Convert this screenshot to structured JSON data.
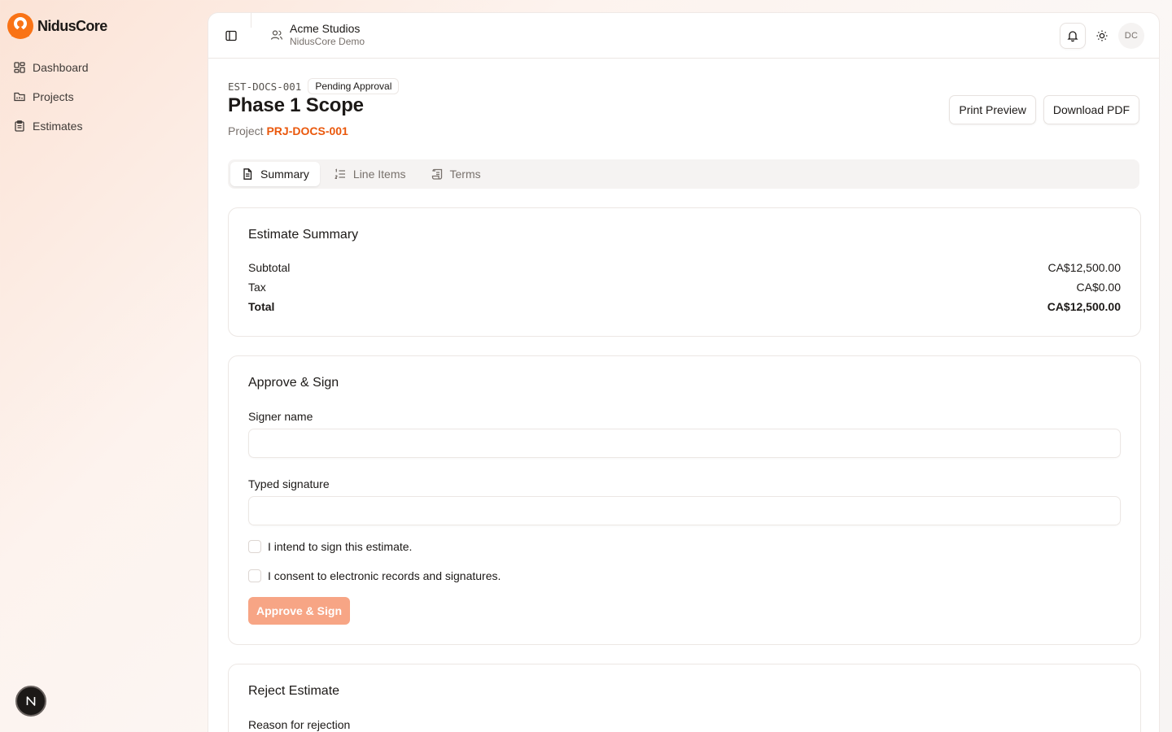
{
  "brand": {
    "name": "NidusCore"
  },
  "sidebar": {
    "items": [
      {
        "label": "Dashboard",
        "icon": "dashboard-icon"
      },
      {
        "label": "Projects",
        "icon": "folder-icon"
      },
      {
        "label": "Estimates",
        "icon": "clipboard-icon"
      }
    ],
    "badge": "N"
  },
  "topbar": {
    "org_name": "Acme Studios",
    "org_sub": "NidusCore Demo",
    "avatar": "DC"
  },
  "page": {
    "doc_id": "EST-DOCS-001",
    "status": "Pending Approval",
    "title": "Phase 1 Scope",
    "project_label": "Project",
    "project_code": "PRJ-DOCS-001",
    "print_label": "Print Preview",
    "download_label": "Download PDF"
  },
  "tabs": [
    {
      "label": "Summary",
      "active": true
    },
    {
      "label": "Line Items",
      "active": false
    },
    {
      "label": "Terms",
      "active": false
    }
  ],
  "summary": {
    "title": "Estimate Summary",
    "rows": [
      {
        "label": "Subtotal",
        "value": "CA$12,500.00"
      },
      {
        "label": "Tax",
        "value": "CA$0.00"
      },
      {
        "label": "Total",
        "value": "CA$12,500.00"
      }
    ]
  },
  "approve": {
    "title": "Approve & Sign",
    "signer_label": "Signer name",
    "signer_value": "",
    "signature_label": "Typed signature",
    "signature_value": "",
    "intent_label": "I intend to sign this estimate.",
    "consent_label": "I consent to electronic records and signatures.",
    "button_label": "Approve & Sign"
  },
  "reject": {
    "title": "Reject Estimate",
    "reason_label": "Reason for rejection"
  },
  "colors": {
    "accent": "#ea580c",
    "accent_disabled": "#f7a585"
  }
}
